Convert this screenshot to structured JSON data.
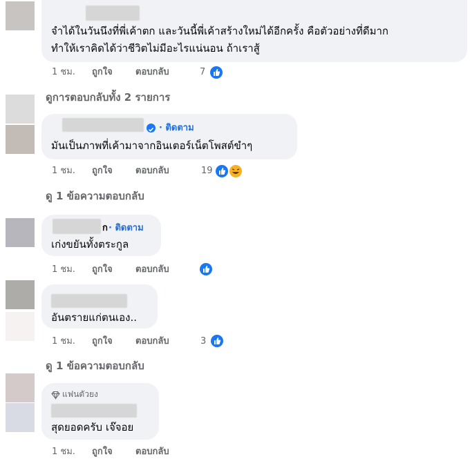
{
  "comments": [
    {
      "text_lines": [
        "จำได้ในวันนึงที่พี่เค้าตก และวันนี้พี่เค้าสร้างใหม่ได้อีกครั้ง คือตัวอย่างที่ดีมาก",
        "ทำให้เราคิดได้ว่าชีวิตไม่มีอะไรแน่นอน ถ้าเราสู้"
      ],
      "time": "1 ชม.",
      "like": "ถูกใจ",
      "reply": "ตอบกลับ",
      "reactions": "7"
    },
    {
      "follow": "· ติดตาม",
      "text": "มันเป็นภาพที่เค้ามาจากอินเตอร์เน็ตโพสต์ขำๆ",
      "time": "1 ชม.",
      "like": "ถูกใจ",
      "reply": "ตอบกลับ",
      "reactions": "19"
    },
    {
      "name_suffix": "ก",
      "follow": "· ติดตาม",
      "text": "เก่งขยันทั้งตระกูล",
      "time": "1 ชม.",
      "like": "ถูกใจ",
      "reply": "ตอบกลับ"
    },
    {
      "text": "อันตรายแก่ตนเอง..",
      "time": "1 ชม.",
      "like": "ถูกใจ",
      "reply": "ตอบกลับ",
      "reactions": "3"
    },
    {
      "badge": "แฟนตัวยง",
      "text": "สุดยอดครับ เจ๊จอย",
      "time": "1 ชม.",
      "like": "ถูกใจ",
      "reply": "ตอบกลับ"
    }
  ],
  "view_replies": [
    "ดูการตอบกลับทั้ง 2 รายการ",
    "ดู 1 ข้อความตอบกลับ",
    "ดู 1 ข้อความตอบกลับ"
  ],
  "icons": {
    "like": "like-reaction-icon",
    "haha": "haha-reaction-icon",
    "verified": "verified-badge-icon",
    "fan": "diamond-icon"
  },
  "colors": {
    "bubble": "#f0f2f5",
    "follow": "#216fdb",
    "meta": "#65676b",
    "like": "#1877f2"
  }
}
